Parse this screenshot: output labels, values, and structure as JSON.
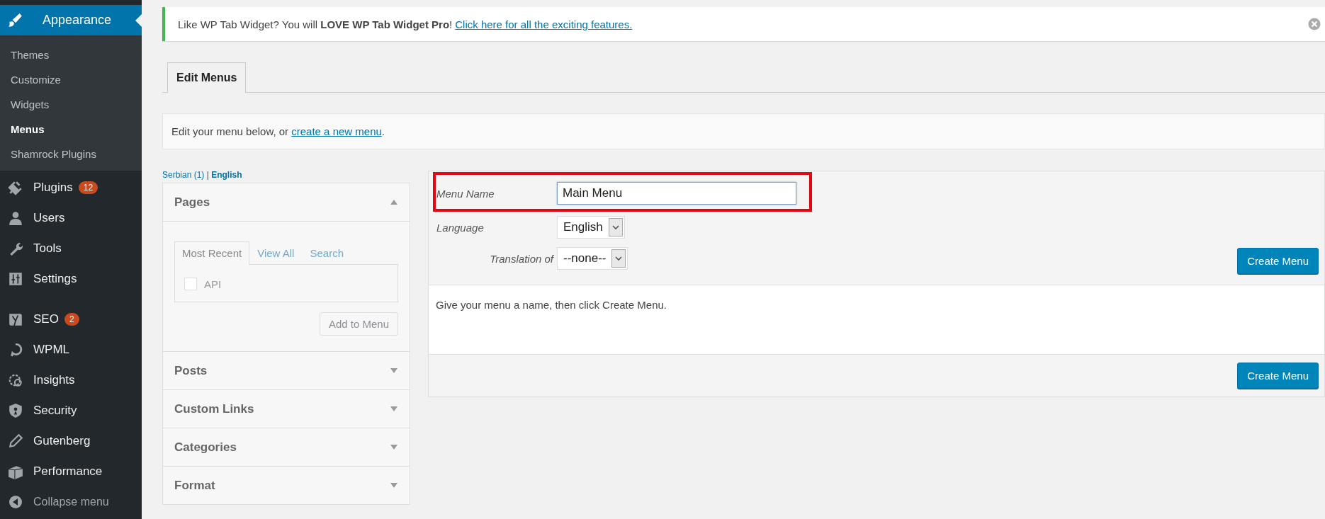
{
  "sidebar": {
    "active": {
      "label": "Appearance",
      "selected": true,
      "submenu": [
        {
          "label": "Themes",
          "selected": false
        },
        {
          "label": "Customize",
          "selected": false
        },
        {
          "label": "Widgets",
          "selected": false
        },
        {
          "label": "Menus",
          "selected": true
        },
        {
          "label": "Shamrock Plugins",
          "selected": false
        }
      ]
    },
    "groups": [
      [
        {
          "label": "Plugins",
          "badge": "12",
          "selected": false
        },
        {
          "label": "Users",
          "selected": false
        },
        {
          "label": "Tools",
          "selected": false
        },
        {
          "label": "Settings",
          "selected": false
        }
      ],
      [
        {
          "label": "SEO",
          "badge": "2",
          "selected": false
        },
        {
          "label": "WPML",
          "selected": false
        },
        {
          "label": "Insights",
          "selected": false
        },
        {
          "label": "Security",
          "selected": false
        },
        {
          "label": "Gutenberg",
          "selected": false
        },
        {
          "label": "Performance",
          "selected": false
        }
      ]
    ],
    "collapse": "Collapse menu"
  },
  "notice": {
    "text": "Like WP Tab Widget? You will **LOVE WP Tab Widget Pro**!",
    "link": "Click here for all the exciting features."
  },
  "tabs": [
    {
      "label": "Edit Menus",
      "selected": true
    }
  ],
  "intro": {
    "text": "Edit your menu below, or ",
    "link": "create a new menu",
    "end": "."
  },
  "language_links": {
    "items": [
      {
        "label": "Serbian (1)",
        "selected": false
      },
      {
        "label": "English",
        "selected": true
      }
    ],
    "separator": "|"
  },
  "sections": [
    {
      "title": "Pages",
      "expanded": true,
      "tabs": [
        {
          "label": "Most Recent",
          "selected": true
        },
        {
          "label": "View All",
          "selected": false
        },
        {
          "label": "Search",
          "selected": false
        }
      ],
      "items": [
        {
          "label": "API",
          "checked": false
        }
      ],
      "button": {
        "label": "Add to Menu",
        "disabled": true
      }
    },
    {
      "title": "Posts",
      "expanded": false
    },
    {
      "title": "Custom Links",
      "expanded": false
    },
    {
      "title": "Categories",
      "expanded": false
    },
    {
      "title": "Format",
      "expanded": false
    }
  ],
  "menu_form": {
    "fields": [
      {
        "kind": "text",
        "label": "Menu Name",
        "value": "Main Menu",
        "highlighted": true
      },
      {
        "kind": "select",
        "label": "Language",
        "value": "English",
        "highlighted": false
      },
      {
        "kind": "select",
        "label": "Translation of",
        "value": "--none--",
        "highlighted": false
      }
    ],
    "button": "Create Menu",
    "message": "Give your menu a name, then click Create Menu.",
    "footer_button": "Create Menu"
  }
}
